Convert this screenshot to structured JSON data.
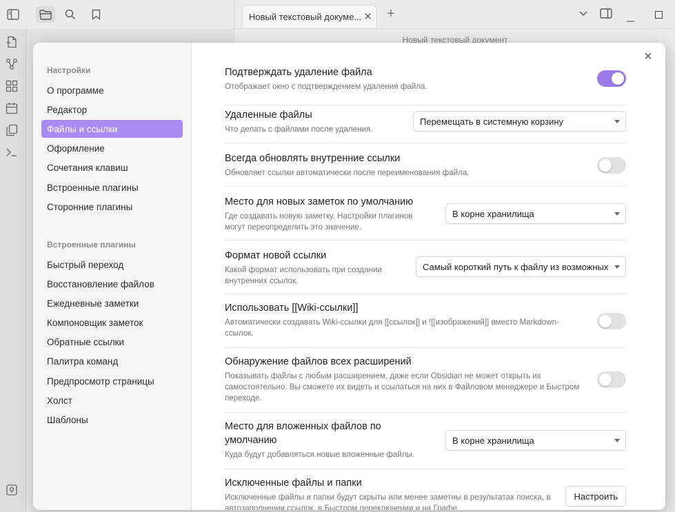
{
  "app": {
    "tab_title": "Новый текстовый докуме...",
    "tab_close": "✕",
    "new_tab": "+",
    "editor_title": "Новый текстовый документ"
  },
  "modal": {
    "close": "×",
    "sidebar": {
      "heading_settings": "Настройки",
      "items": [
        {
          "label": "О программе"
        },
        {
          "label": "Редактор"
        },
        {
          "label": "Файлы и ссылки"
        },
        {
          "label": "Оформление"
        },
        {
          "label": "Сочетания клавиш"
        },
        {
          "label": "Встроенные плагины"
        },
        {
          "label": "Сторонние плагины"
        }
      ],
      "heading_plugins": "Встроенные плагины",
      "plugins": [
        {
          "label": "Быстрый переход"
        },
        {
          "label": "Восстановление файлов"
        },
        {
          "label": "Ежедневные заметки"
        },
        {
          "label": "Компоновщик заметок"
        },
        {
          "label": "Обратные ссылки"
        },
        {
          "label": "Палитра команд"
        },
        {
          "label": "Предпросмотр страницы"
        },
        {
          "label": "Холст"
        },
        {
          "label": "Шаблоны"
        }
      ]
    },
    "settings": [
      {
        "name": "Подтверждать удаление файла",
        "desc": "Отображает окно с подтверждением удаления файла.",
        "control": "toggle",
        "on": true
      },
      {
        "name": "Удаленные файлы",
        "desc": "Что делать с файлами после удаления.",
        "control": "dropdown",
        "value": "Перемещать в системную корзину"
      },
      {
        "name": "Всегда обновлять внутренние ссылки",
        "desc": "Обновляет ссылки автоматически после переименования файла.",
        "control": "toggle",
        "on": false
      },
      {
        "name": "Место для новых заметок по умолчанию",
        "desc": "Где создавать новую заметку. Настройки плагинов могут переопределить это значение.",
        "control": "dropdown",
        "value": "В корне хранилища"
      },
      {
        "name": "Формат новой ссылки",
        "desc": "Какой формат использовать при создании внутренних ссылок.",
        "control": "dropdown",
        "value": "Самый короткий путь к файлу из возможных"
      },
      {
        "name": "Использовать [[Wiki-ссылки]]",
        "desc": "Автоматически создавать Wiki-ссылки для [[ссылок]] и ![[изображений]] вместо Markdown-ссылок.",
        "control": "toggle",
        "on": false
      },
      {
        "name": "Обнаружение файлов всех расширений",
        "desc": "Показывать файлы с любым расширением, даже если Obsidian не может открыть их самостоятельно. Вы сможете их видеть и ссылаться на них в Файловом менеджере и Быстром переходе.",
        "control": "toggle",
        "on": false
      },
      {
        "name": "Место для вложенных файлов по умолчанию",
        "desc": "Куда будут добавляться новые вложенные файлы.",
        "control": "dropdown",
        "value": "В корне хранилища"
      },
      {
        "name": "Исключенные файлы и папки",
        "desc": "Исключенные файлы и папки будут скрыты или менее заметны в результатах поиска, в автозаполнении ссылок, в Быстром переключении и на Графе.",
        "control": "button",
        "value": "Настроить"
      }
    ]
  },
  "colors": {
    "accent": "#9b7bea",
    "sidebar_active": "#a88bf2"
  }
}
